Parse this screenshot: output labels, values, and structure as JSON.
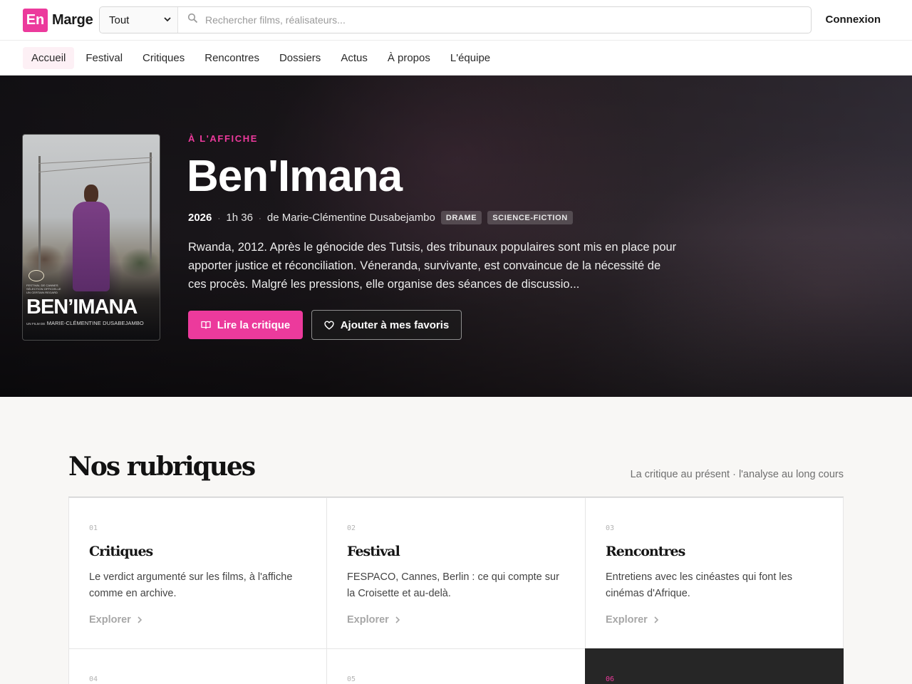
{
  "header": {
    "logo_prefix": "En",
    "logo_name": "Marge",
    "category_select": "Tout",
    "search_placeholder": "Rechercher films, réalisateurs...",
    "login": "Connexion"
  },
  "nav": {
    "items": [
      "Accueil",
      "Festival",
      "Critiques",
      "Rencontres",
      "Dossiers",
      "Actus",
      "À propos",
      "L'équipe"
    ],
    "active": "Accueil"
  },
  "hero": {
    "tag": "À L'AFFICHE",
    "title": "Ben'Imana",
    "year": "2026",
    "duration": "1h 36",
    "director": "de Marie-Clémentine Dusabejambo",
    "genres": [
      "DRAME",
      "SCIENCE-FICTION"
    ],
    "synopsis": "Rwanda, 2012. Après le génocide des Tutsis, des tribunaux populaires sont mis en place pour apporter justice et réconciliation. Véneranda, survivante, est convaincue de la nécessité de ces procès. Malgré les pressions, elle organise des séances de discussio...",
    "read_button": "Lire la critique",
    "favorite_button": "Ajouter à mes favoris",
    "poster": {
      "festival_line1": "FESTIVAL DE CANNES",
      "festival_line2": "SÉLECTION OFFICIELLE",
      "festival_line3": "UN CERTAIN REGARD",
      "title": "BEN’IMANA",
      "credit_prefix": "UN FILM DE",
      "credit_name": "MARIE-CLÉMENTINE DUSABEJAMBO"
    }
  },
  "section": {
    "title": "Nos rubriques",
    "subtitle": "La critique au présent · l'analyse au long cours",
    "explore_label": "Explorer",
    "cards": [
      {
        "num": "01",
        "title": "Critiques",
        "text": "Le verdict argumenté sur les films, à l'affiche comme en archive."
      },
      {
        "num": "02",
        "title": "Festival",
        "text": "FESPACO, Cannes, Berlin : ce qui compte sur la Croisette et au-delà."
      },
      {
        "num": "03",
        "title": "Rencontres",
        "text": "Entretiens avec les cinéastes qui font les cinémas d'Afrique."
      },
      {
        "num": "04"
      },
      {
        "num": "05"
      },
      {
        "num": "06"
      }
    ]
  },
  "colors": {
    "accent": "#ec3a9c",
    "hero_background": "#1b171b",
    "dark_card": "#262626"
  },
  "icons": {
    "search": "search-icon",
    "book": "book-open-icon",
    "heart": "heart-icon",
    "chevron": "chevron-right-icon",
    "select": "chevron-down-icon"
  }
}
